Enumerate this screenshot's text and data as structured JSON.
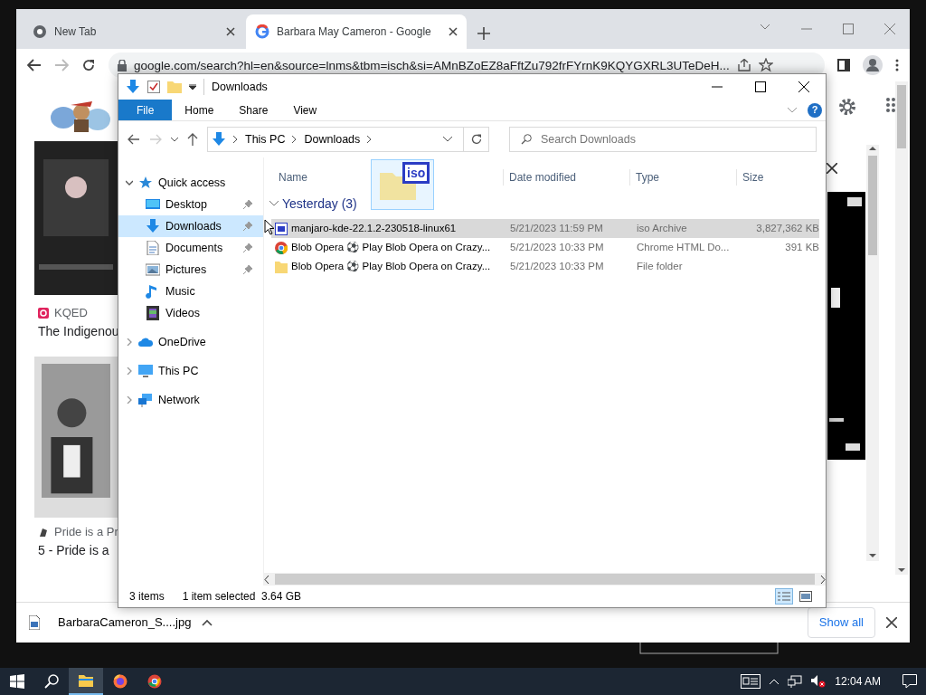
{
  "browser": {
    "tabs": [
      {
        "title": "New Tab",
        "selected": false
      },
      {
        "title": "Barbara May Cameron - Google",
        "selected": true
      }
    ],
    "address": "google.com/search?hl=en&source=lnms&tbm=isch&si=AMnBZoEZ8aFftZu792frFYrnK9KQYGXRL3UTeDeH...",
    "results": [
      {
        "source": "KQED",
        "title": "The Indigenou"
      },
      {
        "source": "Pride is a Pr",
        "title": "5 - Pride is a"
      }
    ],
    "download": {
      "file": "BarbaraCameron_S....jpg",
      "show_all": "Show all"
    }
  },
  "explorer": {
    "title": "Downloads",
    "ribbon_tabs": [
      {
        "label": "File",
        "selected": true
      },
      {
        "label": "Home",
        "selected": false
      },
      {
        "label": "Share",
        "selected": false
      },
      {
        "label": "View",
        "selected": false
      }
    ],
    "breadcrumb": [
      "This PC",
      "Downloads"
    ],
    "search": {
      "placeholder": "Search Downloads"
    },
    "help": "?",
    "nav": [
      {
        "label": "Quick access",
        "expanded": true,
        "children": [
          {
            "label": "Desktop",
            "pinned": true,
            "selected": false
          },
          {
            "label": "Downloads",
            "pinned": true,
            "selected": true
          },
          {
            "label": "Documents",
            "pinned": true,
            "selected": false
          },
          {
            "label": "Pictures",
            "pinned": true,
            "selected": false
          },
          {
            "label": "Music",
            "pinned": false,
            "selected": false
          },
          {
            "label": "Videos",
            "pinned": false,
            "selected": false
          }
        ]
      },
      {
        "label": "OneDrive",
        "expanded": false
      },
      {
        "label": "This PC",
        "expanded": false
      },
      {
        "label": "Network",
        "expanded": false
      }
    ],
    "columns": [
      "Name",
      "Date modified",
      "Type",
      "Size"
    ],
    "group": "Yesterday (3)",
    "drag_label": "iso",
    "files": [
      {
        "name": "manjaro-kde-22.1.2-230518-linux61",
        "date": "5/21/2023 11:59 PM",
        "type": "iso Archive",
        "size": "3,827,362 KB",
        "selected": true
      },
      {
        "name": "Blob Opera ⚽ Play Blob Opera on Crazy...",
        "date": "5/21/2023 10:33 PM",
        "type": "Chrome HTML Do...",
        "size": "391 KB",
        "selected": false
      },
      {
        "name": "Blob Opera ⚽ Play Blob Opera on Crazy...",
        "date": "5/21/2023 10:33 PM",
        "type": "File folder",
        "selected": false
      }
    ],
    "status": [
      "3 items",
      "1 item selected  3.64 GB"
    ]
  },
  "taskbar": {
    "apps": [
      {
        "selected": true
      },
      {
        "selected": false
      },
      {
        "selected": false
      }
    ],
    "time": "12:04 AM"
  }
}
